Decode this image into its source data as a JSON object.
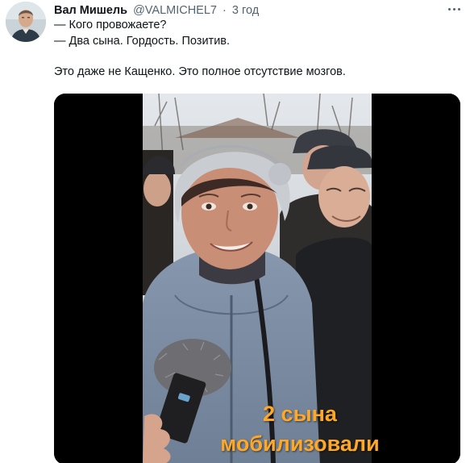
{
  "author": {
    "name": "Вал Мишель",
    "handle": "@VALMICHEL7",
    "separator": "·",
    "time": "3 год"
  },
  "tweet": {
    "lines": [
      "— Кого провожаете?",
      "— Два сына. Гордость. Позитив.",
      "Это даже не Кащенко. Это полное отсутствие мозгов."
    ]
  },
  "media": {
    "caption_line1": "2 сына",
    "caption_line2": "мобилизовали",
    "caption_color": "#ffa726"
  },
  "icons": {
    "more": "more-horizontal-icon"
  },
  "colors": {
    "text": "#0f1419",
    "secondary": "#536471",
    "background": "#ffffff"
  }
}
